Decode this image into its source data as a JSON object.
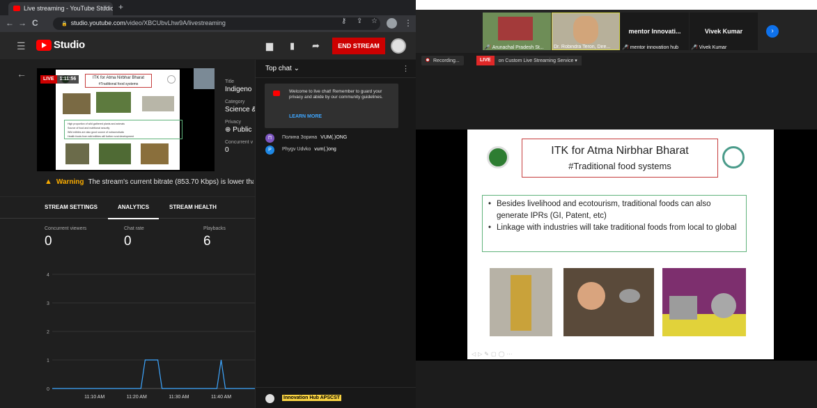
{
  "browser": {
    "tab_title": "Live streaming - YouTube Studio",
    "tab_close": "×",
    "new_tab": "+",
    "url_host": "studio.youtube.com",
    "url_path": "/video/XBCUbvLhw9A/livestreaming"
  },
  "studio": {
    "logo_text": "Studio",
    "end_stream_label": "END STREAM",
    "preview": {
      "live_label": "LIVE",
      "elapsed": "1:11:56",
      "slide_title": "ITK for Atma Nirbhar Bharat",
      "slide_subtitle": "#Traditional food systems",
      "bullets": [
        "High proportion of wild gathered plants and animals",
        "Source of food and nutritional security",
        "Wild edibles are also good source of nutraceuticals",
        "Health foods from wild edibles will further rural development"
      ]
    },
    "info": {
      "title_label": "Title",
      "title_value": "Indigeno",
      "category_label": "Category",
      "category_value": "Science &",
      "privacy_label": "Privacy",
      "privacy_value": "Public",
      "concurrent_label": "Concurrent v",
      "concurrent_value": "0"
    },
    "warning": {
      "title": "Warning",
      "text": "The stream's current bitrate (853.70 Kbps) is lower tha"
    },
    "tabs": [
      "STREAM SETTINGS",
      "ANALYTICS",
      "STREAM HEALTH"
    ],
    "active_tab": "ANALYTICS",
    "metrics": [
      {
        "label": "Concurrent viewers",
        "value": "0"
      },
      {
        "label": "Chat rate",
        "value": "0"
      },
      {
        "label": "Playbacks",
        "value": "6"
      }
    ]
  },
  "chart_data": {
    "type": "line",
    "y_ticks": [
      "0",
      "1",
      "2",
      "3",
      "4"
    ],
    "x_ticks": [
      "11:10 AM",
      "11:20 AM",
      "11:30 AM",
      "11:40 AM"
    ],
    "ylim": [
      0,
      4
    ],
    "x_minutes_range": [
      0,
      48
    ],
    "x_tick_minutes": [
      10,
      20,
      30,
      40
    ],
    "series": [
      {
        "x_minutes": [
          0,
          21,
          22,
          23,
          24,
          25,
          26,
          39,
          40,
          41,
          42,
          48
        ],
        "values": [
          0,
          0,
          1,
          1,
          1,
          1,
          0,
          0,
          1,
          0,
          0,
          0
        ]
      }
    ],
    "color": "#3ea6ff",
    "grid": true
  },
  "chat": {
    "title": "Top chat",
    "welcome_text": "Welcome to live chat! Remember to guard your privacy and abide by our community guidelines.",
    "learn_more": "LEARN MORE",
    "messages": [
      {
        "initial": "П",
        "author": "Полина Зорина",
        "text": "VUM(.)ONG",
        "color": "#7e57c2"
      },
      {
        "initial": "P",
        "author": "Phygv Udvko",
        "text": "vum(.)ong",
        "color": "#1e88e5"
      }
    ],
    "footer_name": "Innovation Hub APSCST"
  },
  "meeting": {
    "participants": [
      {
        "label": "Arunachal Pradesh St..."
      },
      {
        "label": "Dr. Robindra Teron, Dire..."
      },
      {
        "label": "mentor innovation hub",
        "big_name": "mentor Innovati..."
      },
      {
        "label": "Vivek Kumar",
        "big_name": "Vivek Kumar"
      }
    ],
    "recording_label": "Recording...",
    "live_label": "LIVE",
    "live_service": "on Custom Live Streaming Service ▾",
    "slide": {
      "title": "ITK for Atma Nirbhar Bharat",
      "subtitle": "#Traditional food systems",
      "bullets": [
        "Besides livelihood and ecotourism, traditional foods can also generate IPRs (GI, Patent, etc)",
        "Linkage with industries will take traditional foods from local to global"
      ]
    }
  }
}
